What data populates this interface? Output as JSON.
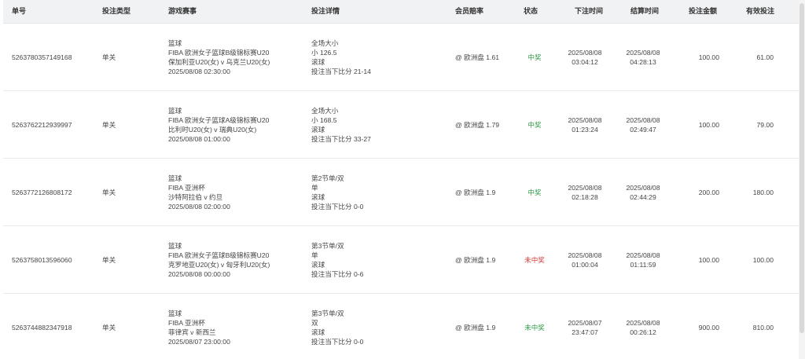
{
  "columns": {
    "id": "单号",
    "type": "投注类型",
    "event": "游戏赛事",
    "detail": "投注详情",
    "odds": "会员赔率",
    "status": "状态",
    "bet_time": "下注时间",
    "settle_time": "结算时间",
    "amount": "投注金额",
    "valid": "有效投注"
  },
  "rows": [
    {
      "id": "5263780357149168",
      "type": "单关",
      "event": [
        "篮球",
        "FIBA 欧洲女子篮球B级锦标赛U20",
        "保加利亚U20(女) v 乌克兰U20(女)",
        "2025/08/08 02:30:00"
      ],
      "detail": [
        "全场大小",
        "小 126.5",
        "滚球",
        "投注当下比分 21-14"
      ],
      "odds": "@ 欧洲盘 1.61",
      "status": "中奖",
      "status_kind": "win",
      "bet_date": "2025/08/08",
      "bet_time": "03:04:12",
      "settle_date": "2025/08/08",
      "settle_time": "04:28:13",
      "amount": "100.00",
      "valid": "61.00"
    },
    {
      "id": "5263762212939997",
      "type": "单关",
      "event": [
        "篮球",
        "FIBA 欧洲女子篮球A级锦标赛U20",
        "比利时U20(女) v 瑞典U20(女)",
        "2025/08/08 01:00:00"
      ],
      "detail": [
        "全场大小",
        "小 168.5",
        "滚球",
        "投注当下比分 33-27"
      ],
      "odds": "@ 欧洲盘 1.79",
      "status": "中奖",
      "status_kind": "win",
      "bet_date": "2025/08/08",
      "bet_time": "01:23:24",
      "settle_date": "2025/08/08",
      "settle_time": "02:49:47",
      "amount": "100.00",
      "valid": "79.00"
    },
    {
      "id": "5263772126808172",
      "type": "单关",
      "event": [
        "篮球",
        "FIBA 亚洲杯",
        "沙特阿拉伯 v 约旦",
        "2025/08/08 02:00:00"
      ],
      "detail": [
        "第2节单/双",
        "单",
        "滚球",
        "投注当下比分 0-0"
      ],
      "odds": "@ 欧洲盘 1.9",
      "status": "中奖",
      "status_kind": "win",
      "bet_date": "2025/08/08",
      "bet_time": "02:18:28",
      "settle_date": "2025/08/08",
      "settle_time": "02:44:29",
      "amount": "200.00",
      "valid": "180.00"
    },
    {
      "id": "5263758013596060",
      "type": "单关",
      "event": [
        "篮球",
        "FIBA 欧洲女子篮球B级锦标赛U20",
        "克罗地亚U20(女) v 匈牙利U20(女)",
        "2025/08/08 00:00:00"
      ],
      "detail": [
        "第3节单/双",
        "单",
        "滚球",
        "投注当下比分 0-6"
      ],
      "odds": "@ 欧洲盘 1.9",
      "status": "未中奖",
      "status_kind": "lose",
      "bet_date": "2025/08/08",
      "bet_time": "01:00:04",
      "settle_date": "2025/08/08",
      "settle_time": "01:11:59",
      "amount": "100.00",
      "valid": "100.00"
    },
    {
      "id": "5263744882347918",
      "type": "单关",
      "event": [
        "篮球",
        "FIBA 亚洲杯",
        "菲律宾 v 新西兰",
        "2025/08/07 23:00:00"
      ],
      "detail": [
        "第3节单/双",
        "双",
        "滚球",
        "投注当下比分 0-0"
      ],
      "odds": "@ 欧洲盘 1.9",
      "status": "未中奖",
      "status_kind": "win",
      "bet_date": "2025/08/07",
      "bet_time": "23:47:07",
      "settle_date": "2025/08/08",
      "settle_time": "00:26:12",
      "amount": "900.00",
      "valid": "810.00"
    }
  ],
  "colors": {
    "win": "#2f9a47",
    "lose": "#d23a3a",
    "header_bg": "#f1f2f4"
  }
}
